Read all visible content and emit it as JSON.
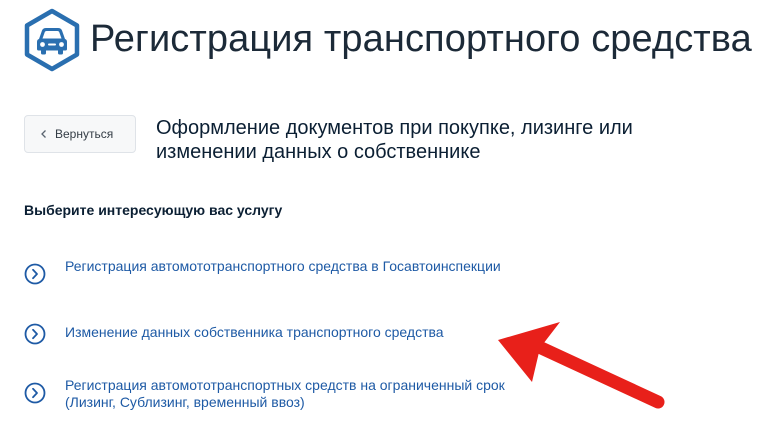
{
  "header": {
    "title": "Регистрация транспортного средства",
    "logo_icon": "car-icon"
  },
  "toolbar": {
    "back_label": "Вернуться"
  },
  "section": {
    "title": "Оформление документов при покупке, лизинге или изменении данных о собственнике"
  },
  "services": {
    "heading": "Выберите интересующую вас услугу",
    "items": [
      {
        "label": "Регистрация автомототранспортного средства в Госавтоинспекции"
      },
      {
        "label": "Изменение данных собственника транспортного средства"
      },
      {
        "label": "Регистрация автомототранспортных средств на ограниченный срок (Лизинг, Сублизинг, временный ввоз)"
      }
    ]
  },
  "colors": {
    "link": "#1e5aa5",
    "logo": "#2a6fb0",
    "annotation_arrow": "#e8201a"
  }
}
